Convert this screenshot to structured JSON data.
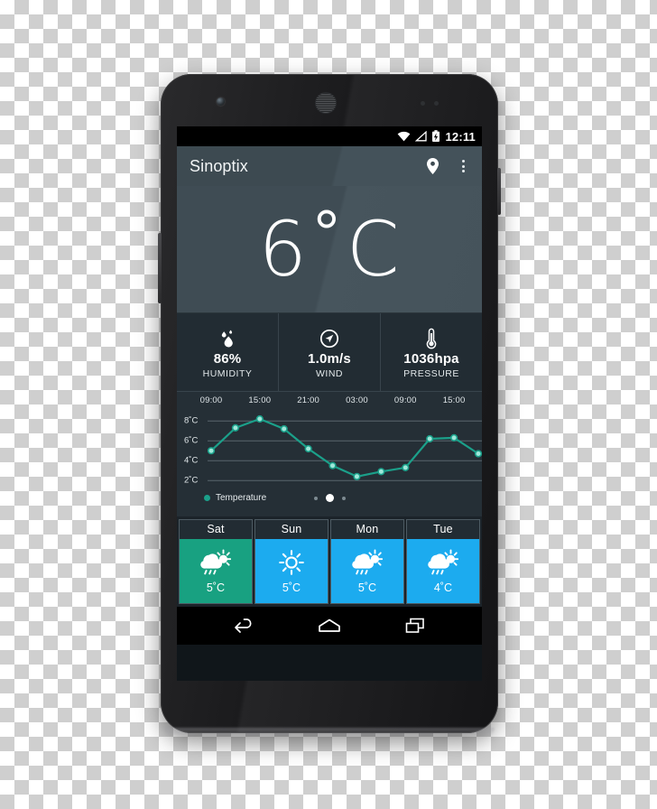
{
  "status_bar": {
    "clock": "12:11",
    "icons": [
      "wifi-icon",
      "signal-icon",
      "battery-charging-icon"
    ]
  },
  "app_bar": {
    "title": "Sinoptix",
    "location_icon": "location-pin-icon",
    "overflow_icon": "overflow-menu-icon"
  },
  "hero": {
    "temperature": "6˚C"
  },
  "stats": [
    {
      "icon": "humidity-droplet-icon",
      "value": "86%",
      "label": "HUMIDITY"
    },
    {
      "icon": "wind-compass-icon",
      "value": "1.0m/s",
      "label": "WIND"
    },
    {
      "icon": "pressure-thermometer-icon",
      "value": "1036hpa",
      "label": "PRESSURE"
    }
  ],
  "chart_data": {
    "type": "line",
    "title": "",
    "xlabel": "",
    "ylabel": "",
    "legend": [
      "Temperature"
    ],
    "legend_position": "bottom-left",
    "grid": true,
    "line_color": "#1ba08a",
    "point_color": "#9fe8da",
    "x_tick_labels": [
      "09:00",
      "15:00",
      "21:00",
      "03:00",
      "09:00",
      "15:00"
    ],
    "y_tick_labels": [
      "8˚C",
      "6˚C",
      "4˚C",
      "2˚C"
    ],
    "y_ticks": [
      8,
      6,
      4,
      2
    ],
    "ylim": [
      1.2,
      9.2
    ],
    "series": [
      {
        "name": "Temperature",
        "values": [
          5.0,
          7.3,
          8.2,
          7.2,
          5.2,
          3.5,
          2.4,
          2.9,
          3.3,
          6.2,
          6.3,
          4.7
        ]
      }
    ],
    "x": [
      0,
      1,
      2,
      3,
      4,
      5,
      6,
      7,
      8,
      9,
      10,
      11
    ]
  },
  "pagination": {
    "count": 3,
    "active_index": 1
  },
  "forecast": [
    {
      "day": "Sat",
      "icon": "sun-rain-cloud-icon",
      "temp": "5˚C",
      "color": "#18a181"
    },
    {
      "day": "Sun",
      "icon": "sun-icon",
      "temp": "5˚C",
      "color": "#1cabef"
    },
    {
      "day": "Mon",
      "icon": "sun-rain-cloud-icon",
      "temp": "5˚C",
      "color": "#1cabef"
    },
    {
      "day": "Tue",
      "icon": "sun-rain-cloud-icon",
      "temp": "4˚C",
      "color": "#1cabef"
    }
  ],
  "nav_bar": {
    "back": "back-icon",
    "home": "home-icon",
    "recents": "recents-icon"
  },
  "colors": {
    "app_bar": "#3d4a51",
    "hero": "#414e56",
    "stats_bg": "#222c33",
    "chart_bg": "#252f36",
    "accent_teal": "#18a181",
    "accent_blue": "#1cabef"
  }
}
